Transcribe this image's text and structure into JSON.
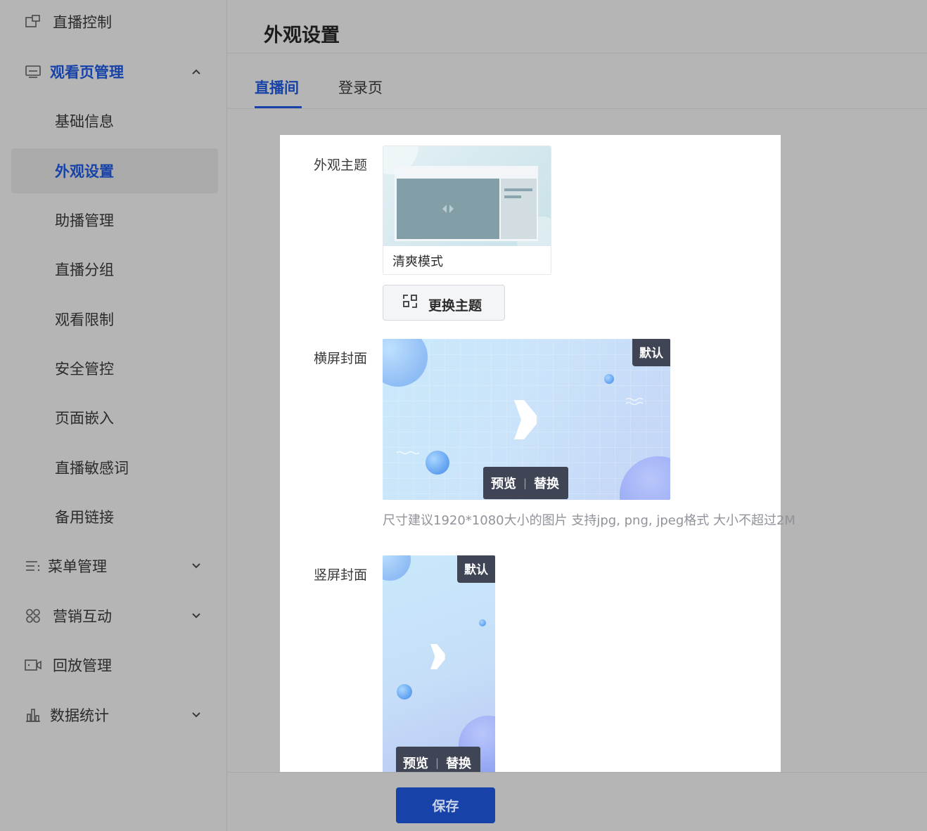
{
  "sidebar": {
    "items": [
      {
        "label": "直播控制",
        "icon": "screen-share-icon"
      },
      {
        "label": "观看页管理",
        "icon": "watch-page-icon",
        "expanded": true
      },
      {
        "label": "菜单管理",
        "icon": "menu-list-icon"
      },
      {
        "label": "营销互动",
        "icon": "apps-grid-icon"
      },
      {
        "label": "回放管理",
        "icon": "video-camera-icon"
      },
      {
        "label": "数据统计",
        "icon": "bar-chart-icon"
      }
    ],
    "sub_items": [
      {
        "label": "基础信息"
      },
      {
        "label": "外观设置",
        "selected": true
      },
      {
        "label": "助播管理"
      },
      {
        "label": "直播分组"
      },
      {
        "label": "观看限制"
      },
      {
        "label": "安全管控"
      },
      {
        "label": "页面嵌入"
      },
      {
        "label": "直播敏感词"
      },
      {
        "label": "备用链接"
      }
    ]
  },
  "header": {
    "title": "外观设置"
  },
  "tabs": [
    {
      "label": "直播间",
      "active": true
    },
    {
      "label": "登录页"
    }
  ],
  "form": {
    "theme": {
      "label": "外观主题",
      "current_theme_name": "清爽模式",
      "change_button": "更换主题"
    },
    "landscape_cover": {
      "label": "横屏封面",
      "badge": "默认",
      "preview": "预览",
      "separator": "|",
      "replace": "替换",
      "hint": "尺寸建议1920*1080大小的图片  支持jpg, png, jpeg格式  大小不超过2M"
    },
    "portrait_cover": {
      "label": "竖屏封面",
      "badge": "默认",
      "preview": "预览",
      "separator": "|",
      "replace": "替换"
    }
  },
  "footer": {
    "save_label": "保存"
  },
  "colors": {
    "accent": "#1742a8",
    "overlay": "#3f4555",
    "hint": "#909399"
  }
}
